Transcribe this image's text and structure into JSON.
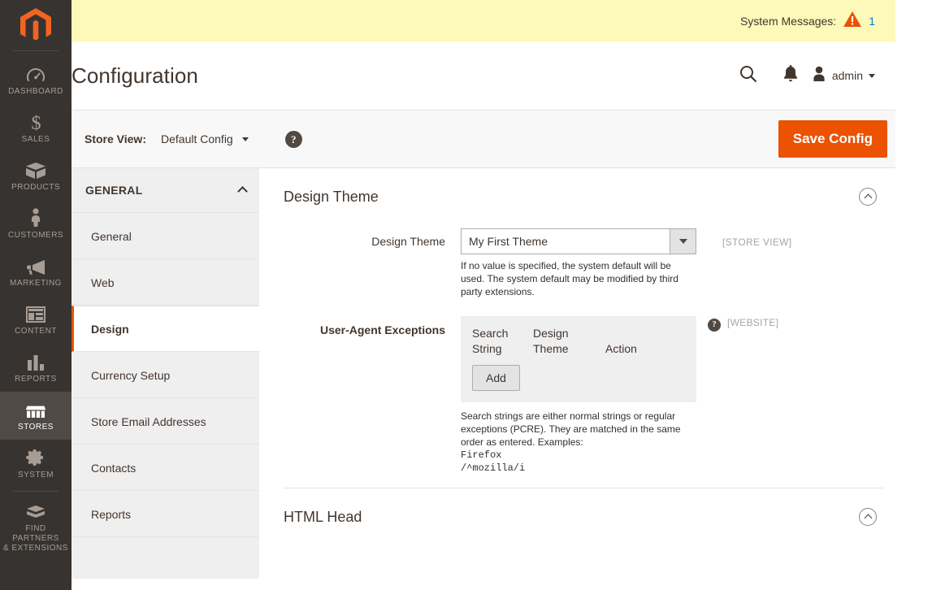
{
  "rail": {
    "logo_name": "magento-logo",
    "items": [
      {
        "label": "DASHBOARD",
        "icon": "dashboard-icon",
        "active": false
      },
      {
        "label": "SALES",
        "icon": "dollar-icon",
        "active": false
      },
      {
        "label": "PRODUCTS",
        "icon": "box-icon",
        "active": false
      },
      {
        "label": "CUSTOMERS",
        "icon": "person-icon",
        "active": false
      },
      {
        "label": "MARKETING",
        "icon": "megaphone-icon",
        "active": false
      },
      {
        "label": "CONTENT",
        "icon": "layout-icon",
        "active": false
      },
      {
        "label": "REPORTS",
        "icon": "bar-chart-icon",
        "active": false
      },
      {
        "label": "STORES",
        "icon": "storefront-icon",
        "active": true
      },
      {
        "label": "SYSTEM",
        "icon": "gear-icon",
        "active": false
      },
      {
        "label": "FIND PARTNERS\n& EXTENSIONS",
        "icon": "puzzle-box-icon",
        "active": false
      }
    ],
    "find_partners_line1": "FIND PARTNERS",
    "find_partners_line2": "& EXTENSIONS"
  },
  "system_messages": {
    "label": "System Messages:",
    "count": "1",
    "icon": "warning-triangle-icon",
    "bg_color": "#fdf9b8",
    "count_color": "#007bdb"
  },
  "header": {
    "title": "Configuration",
    "search_icon": "search-icon",
    "notifications_icon": "bell-icon",
    "avatar_icon": "user-avatar-icon",
    "admin_name": "admin",
    "caret_icon": "chevron-down-icon"
  },
  "store_bar": {
    "label": "Store View:",
    "selected": "Default Config",
    "help_icon": "question-mark-icon",
    "save_label": "Save Config",
    "save_color": "#eb5202"
  },
  "config_nav": {
    "group_title": "GENERAL",
    "collapse_icon": "chevron-up-icon",
    "items": [
      {
        "label": "General",
        "active": false
      },
      {
        "label": "Web",
        "active": false
      },
      {
        "label": "Design",
        "active": true
      },
      {
        "label": "Currency Setup",
        "active": false
      },
      {
        "label": "Store Email Addresses",
        "active": false
      },
      {
        "label": "Contacts",
        "active": false
      },
      {
        "label": "Reports",
        "active": false
      }
    ]
  },
  "sections": {
    "design_theme": {
      "title": "Design Theme",
      "collapse_icon": "circle-chevron-up-icon",
      "theme_field": {
        "label": "Design Theme",
        "value": "My First Theme",
        "arrow_icon": "dropdown-arrow-icon",
        "note": "If no value is specified, the system default will be used. The system default may be modified by third party extensions.",
        "scope": "[STORE VIEW]"
      },
      "ua_field": {
        "label": "User-Agent Exceptions",
        "col_search_string_l1": "Search",
        "col_search_string_l2": "String",
        "col_design_theme_l1": "Design",
        "col_design_theme_l2": "Theme",
        "col_action": "Action",
        "add_label": "Add",
        "help_icon": "question-mark-icon",
        "scope": "[WEBSITE]",
        "note": "Search strings are either normal strings or regular exceptions (PCRE). They are matched in the same order as entered. Examples:",
        "example_1": "Firefox",
        "example_2": "/^mozilla/i"
      }
    },
    "html_head": {
      "title": "HTML Head",
      "collapse_icon": "circle-chevron-up-icon"
    }
  }
}
